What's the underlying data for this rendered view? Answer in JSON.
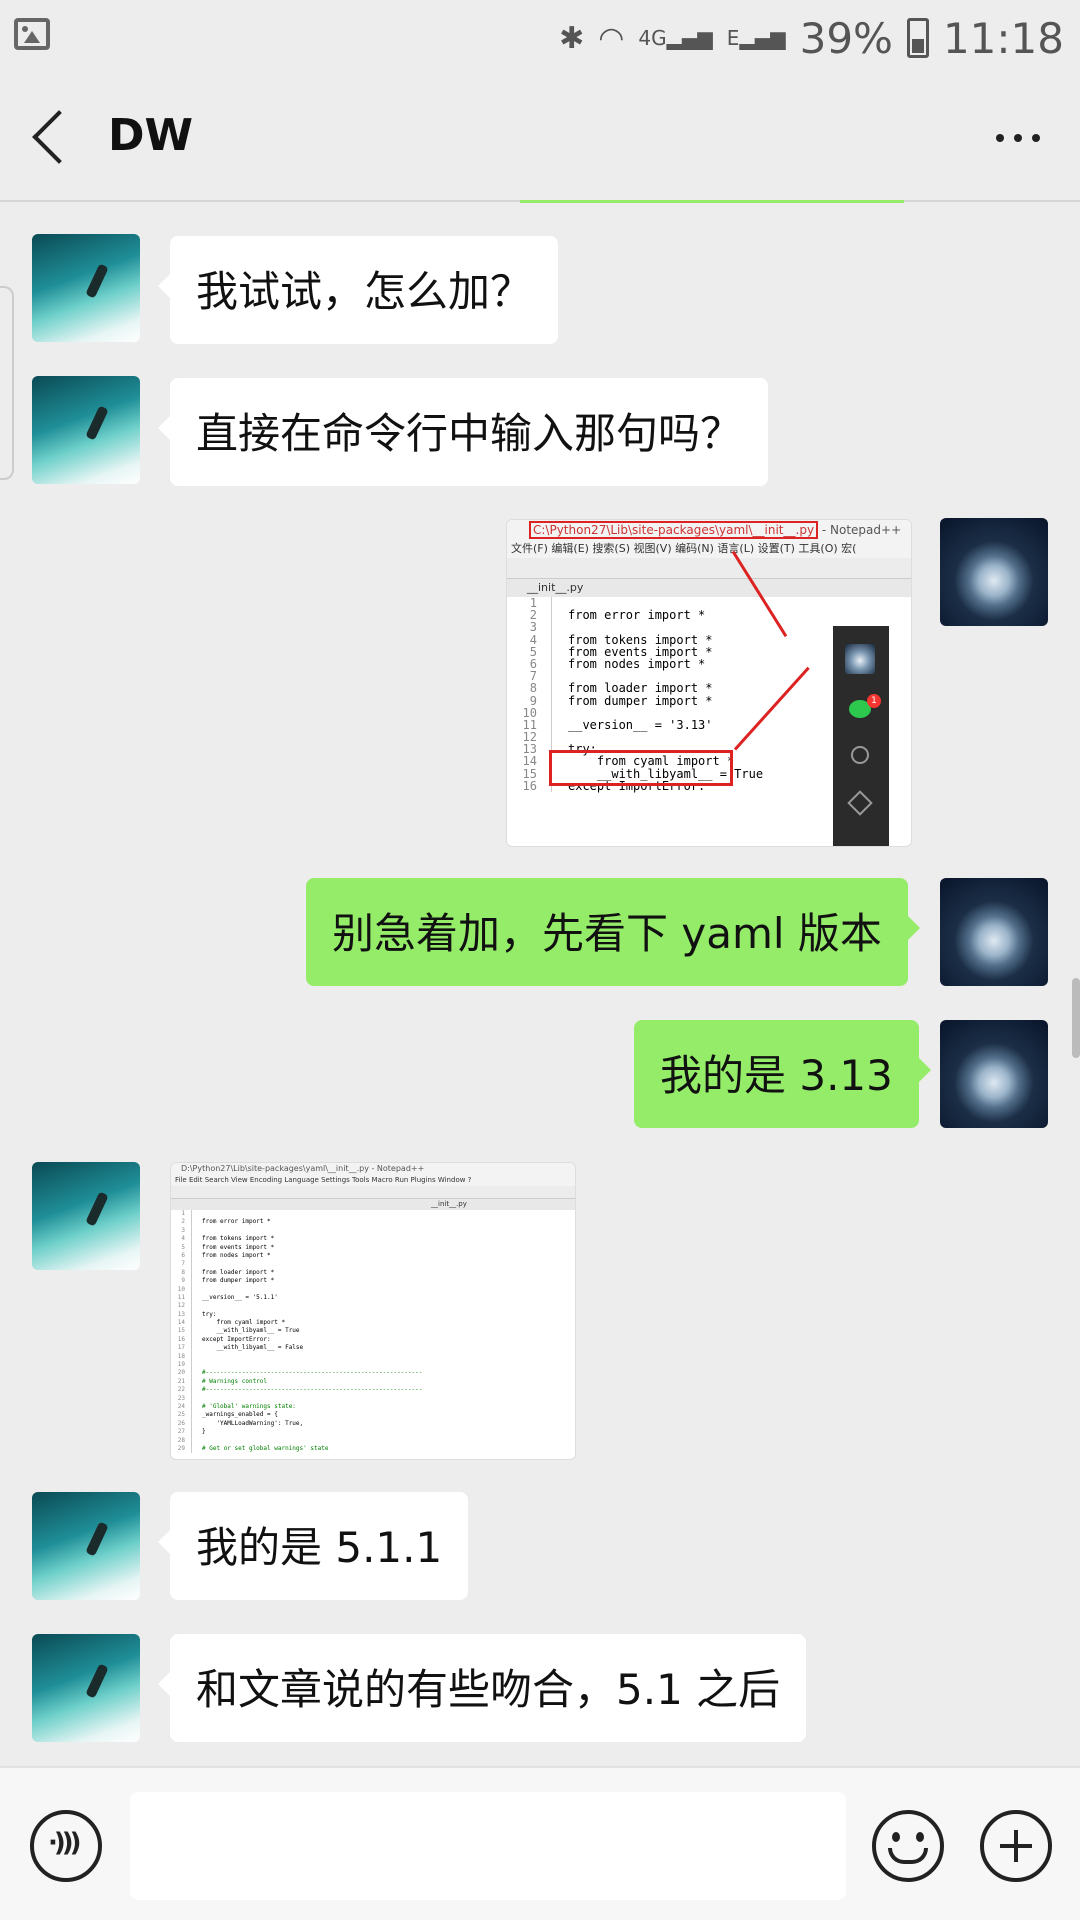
{
  "status_bar": {
    "icons": [
      "gallery-icon",
      "bluetooth-icon",
      "wifi-icon",
      "signal-4g-icon",
      "signal-e-icon",
      "battery-icon"
    ],
    "network_4g": "4G",
    "network_e": "E",
    "battery": "39%",
    "time": "11:18"
  },
  "header": {
    "title": "DW",
    "back_icon": "chevron-left-icon",
    "more_icon": "more-dots-icon"
  },
  "messages": [
    {
      "side": "left",
      "type": "text",
      "text": "我试试，怎么加？"
    },
    {
      "side": "left",
      "type": "text",
      "text": "直接在命令行中输入那句吗？"
    },
    {
      "side": "right",
      "type": "image",
      "description_icon": "notepad-screenshot"
    },
    {
      "side": "right",
      "type": "text",
      "text": "别急着加，先看下 yaml 版本"
    },
    {
      "side": "right",
      "type": "text",
      "text": "我的是 3.13"
    },
    {
      "side": "left",
      "type": "image",
      "description_icon": "notepad-screenshot"
    },
    {
      "side": "left",
      "type": "text",
      "text": "我的是 5.1.1"
    },
    {
      "side": "left",
      "type": "text",
      "text": "和文章说的有些吻合，5.1 之后"
    }
  ],
  "screenshot1": {
    "title_path": "C:\\Python27\\Lib\\site-packages\\yaml\\__init__.py",
    "title_app": "- Notepad++",
    "menu": "文件(F)  编辑(E)  搜索(S)  视图(V)  编码(N)  语言(L)  设置(T)  工具(O)  宏(",
    "tab": "__init__.py",
    "code": [
      {
        "n": "1",
        "t": ""
      },
      {
        "n": "2",
        "t": "from error import *"
      },
      {
        "n": "3",
        "t": ""
      },
      {
        "n": "4",
        "t": "from tokens import *"
      },
      {
        "n": "5",
        "t": "from events import *"
      },
      {
        "n": "6",
        "t": "from nodes import *"
      },
      {
        "n": "7",
        "t": ""
      },
      {
        "n": "8",
        "t": "from loader import *"
      },
      {
        "n": "9",
        "t": "from dumper import *"
      },
      {
        "n": "10",
        "t": ""
      },
      {
        "n": "11",
        "t": "__version__ = '3.13'"
      },
      {
        "n": "12",
        "t": ""
      },
      {
        "n": "13",
        "t": "try:"
      },
      {
        "n": "14",
        "t": "    from cyaml import *"
      },
      {
        "n": "15",
        "t": "    __with_libyaml__ = True"
      },
      {
        "n": "16",
        "t": "except ImportError:"
      }
    ],
    "badge": "1"
  },
  "screenshot2": {
    "title": "D:\\Python27\\Lib\\site-packages\\yaml\\__init__.py - Notepad++",
    "menu": "File  Edit  Search  View  Encoding  Language  Settings  Tools  Macro  Run  Plugins  Window  ?",
    "tabs": "__init__.py",
    "code": [
      {
        "n": "1",
        "t": ""
      },
      {
        "n": "2",
        "t": "from error import *"
      },
      {
        "n": "3",
        "t": ""
      },
      {
        "n": "4",
        "t": "from tokens import *"
      },
      {
        "n": "5",
        "t": "from events import *"
      },
      {
        "n": "6",
        "t": "from nodes import *"
      },
      {
        "n": "7",
        "t": ""
      },
      {
        "n": "8",
        "t": "from loader import *"
      },
      {
        "n": "9",
        "t": "from dumper import *"
      },
      {
        "n": "10",
        "t": ""
      },
      {
        "n": "11",
        "t": "__version__ = '5.1.1'"
      },
      {
        "n": "12",
        "t": ""
      },
      {
        "n": "13",
        "t": "try:"
      },
      {
        "n": "14",
        "t": "    from cyaml import *"
      },
      {
        "n": "15",
        "t": "    __with_libyaml__ = True"
      },
      {
        "n": "16",
        "t": "except ImportError:"
      },
      {
        "n": "17",
        "t": "    __with_libyaml__ = False"
      },
      {
        "n": "18",
        "t": ""
      },
      {
        "n": "19",
        "t": ""
      },
      {
        "n": "20",
        "t": "#------------------------------------------------------------"
      },
      {
        "n": "21",
        "t": "# Warnings control"
      },
      {
        "n": "22",
        "t": "#------------------------------------------------------------"
      },
      {
        "n": "23",
        "t": ""
      },
      {
        "n": "24",
        "t": "# 'Global' warnings state:"
      },
      {
        "n": "25",
        "t": "_warnings_enabled = {"
      },
      {
        "n": "26",
        "t": "    'YAMLLoadWarning': True,"
      },
      {
        "n": "27",
        "t": "}"
      },
      {
        "n": "28",
        "t": ""
      },
      {
        "n": "29",
        "t": "# Get or set global warnings' state"
      }
    ]
  },
  "input_bar": {
    "voice_icon": "voice-icon",
    "emoji_icon": "emoji-icon",
    "plus_icon": "plus-icon",
    "placeholder": ""
  },
  "colors": {
    "background": "#ededed",
    "bubble_right": "#95ec69",
    "bubble_left": "#ffffff",
    "highlight_red": "#dd2222"
  }
}
